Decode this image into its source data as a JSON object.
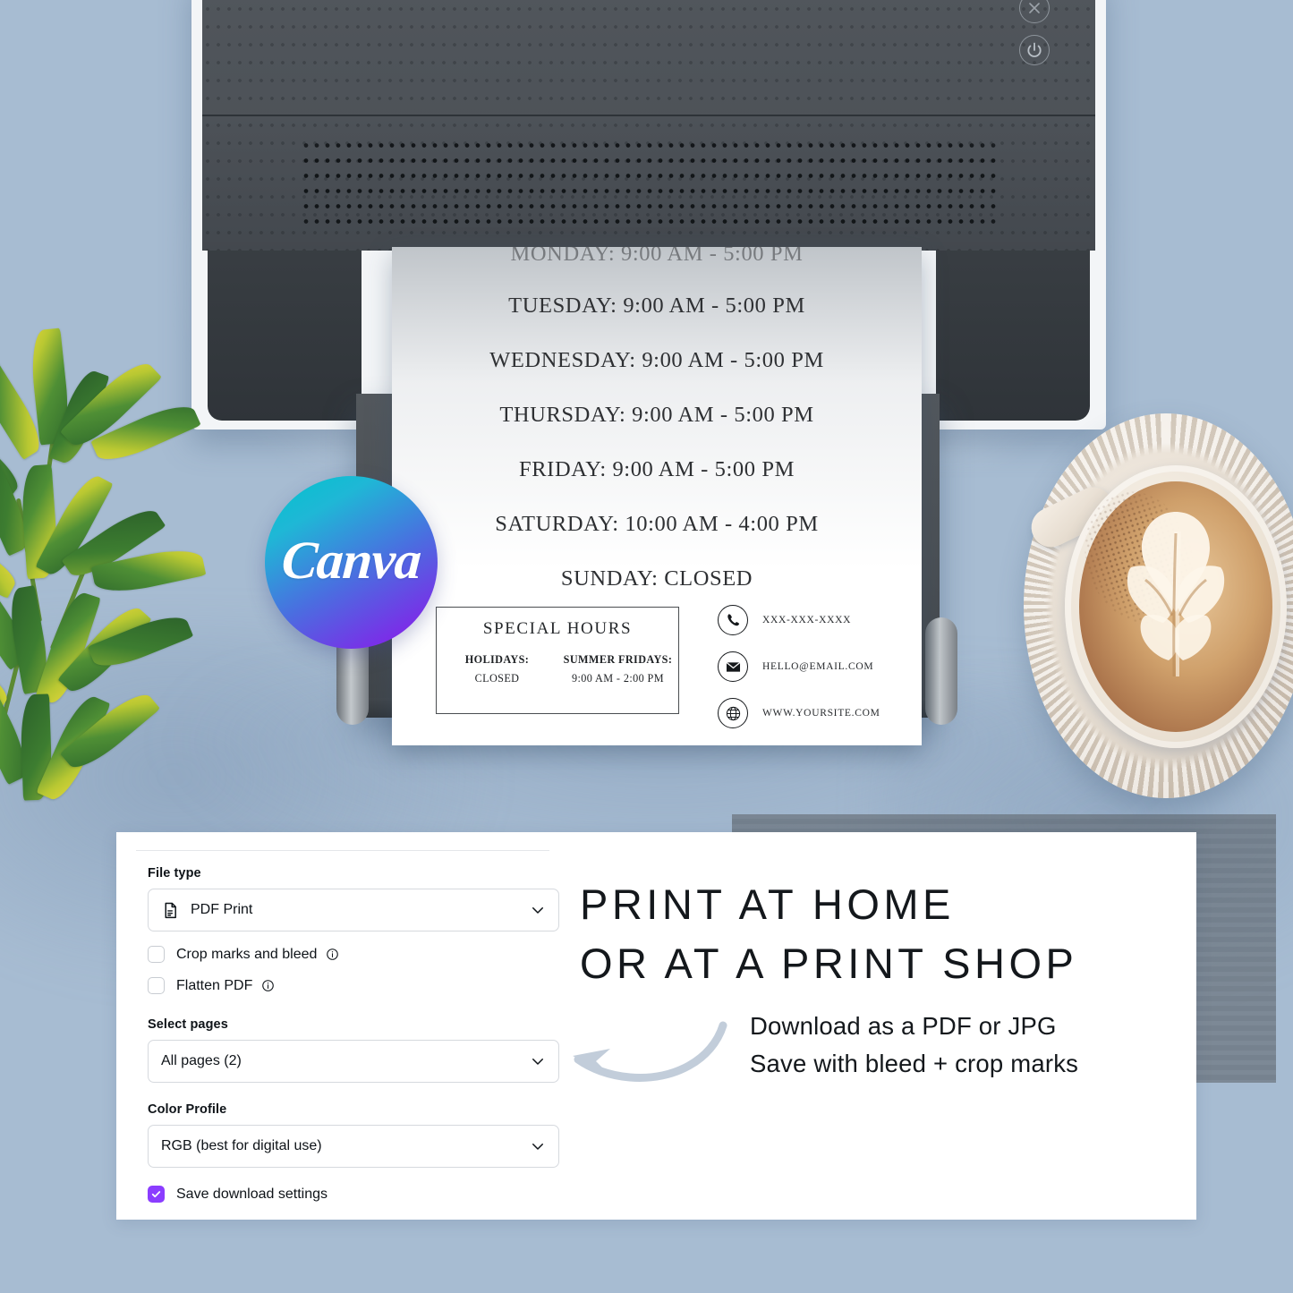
{
  "background_color": "#a7bcd2",
  "scene": {
    "printer": {
      "name": "printer",
      "cancel_icon": "close-x-icon",
      "power_icon": "power-icon"
    },
    "canva_badge": {
      "wordmark": "Canva",
      "gradient_from": "#00c4cc",
      "gradient_to": "#8b3dff"
    },
    "plant": {
      "name": "houseplant"
    },
    "coffee": {
      "name": "latte-cup-and-saucer"
    }
  },
  "printed_page": {
    "clipped_top_row": "MONDAY: 9:00 AM  -  5:00 PM",
    "hours": [
      "TUESDAY: 9:00 AM  -  5:00 PM",
      "WEDNESDAY: 9:00 AM  -  5:00 PM",
      "THURSDAY: 9:00 AM  -  5:00 PM",
      "FRIDAY: 9:00 AM  -  5:00 PM",
      "SATURDAY: 10:00 AM  -  4:00 PM",
      "SUNDAY: CLOSED"
    ],
    "special_hours": {
      "title": "SPECIAL HOURS",
      "columns": [
        {
          "head": "HOLIDAYS:",
          "value": "CLOSED"
        },
        {
          "head": "SUMMER FRIDAYS:",
          "value": "9:00 AM - 2:00 PM"
        }
      ]
    },
    "contact": [
      {
        "icon": "phone-icon",
        "text": "XXX-XXX-XXXX"
      },
      {
        "icon": "email-icon",
        "text": "HELLO@EMAIL.COM"
      },
      {
        "icon": "globe-icon",
        "text": "WWW.YOURSITE.COM"
      }
    ]
  },
  "download_panel": {
    "file_type": {
      "label": "File type",
      "value": "PDF Print",
      "icon": "document-icon",
      "chevron": "chevron-down-icon"
    },
    "options": [
      {
        "label": "Crop marks and bleed",
        "checked": false,
        "info": "info-icon"
      },
      {
        "label": "Flatten PDF",
        "checked": false,
        "info": "info-icon"
      }
    ],
    "select_pages": {
      "label": "Select pages",
      "value": "All pages (2)",
      "chevron": "chevron-down-icon"
    },
    "color_profile": {
      "label": "Color Profile",
      "value": "RGB (best for digital use)",
      "chevron": "chevron-down-icon"
    },
    "save_settings": {
      "label": "Save download settings",
      "checked": true,
      "accent_color": "#8b3dff"
    }
  },
  "promo": {
    "headline_line1": "PRINT AT HOME",
    "headline_line2": "OR AT A PRINT SHOP",
    "sub_line1": "Download as a PDF or JPG",
    "sub_line2": "Save with bleed + crop marks",
    "arrow": "curved-arrow-left-icon",
    "arrow_color": "#c2cdda"
  }
}
